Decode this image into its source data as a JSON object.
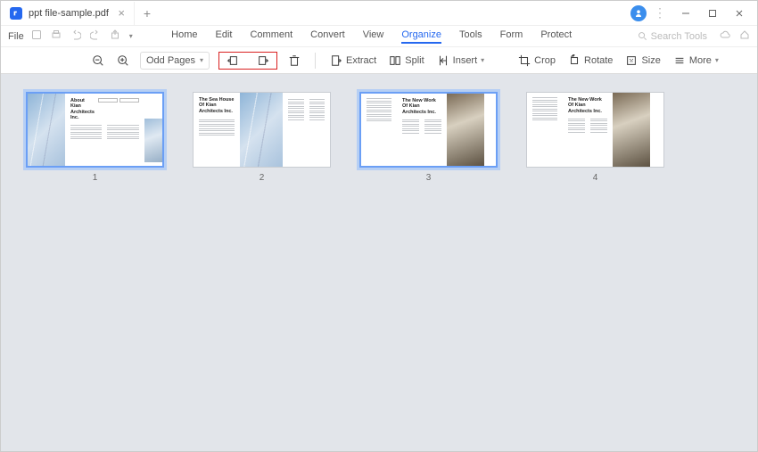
{
  "tab": {
    "title": "ppt file-sample.pdf"
  },
  "menubar": {
    "file": "File",
    "items": [
      "Home",
      "Edit",
      "Comment",
      "Convert",
      "View",
      "Organize",
      "Tools",
      "Form",
      "Protect"
    ],
    "active_index": 5,
    "search_placeholder": "Search Tools"
  },
  "toolbar": {
    "filter_label": "Odd Pages",
    "extract": "Extract",
    "split": "Split",
    "insert": "Insert",
    "crop": "Crop",
    "rotate": "Rotate",
    "size": "Size",
    "more": "More"
  },
  "pages": [
    {
      "num": "1",
      "title": "About Kian Architects Inc.",
      "selected": true,
      "style": "blue",
      "layout": "a"
    },
    {
      "num": "2",
      "title": "The Sea House Of Kian Architects Inc.",
      "selected": false,
      "style": "blue",
      "layout": "b"
    },
    {
      "num": "3",
      "title": "The New Work Of Kian Architects Inc.",
      "selected": true,
      "style": "brown",
      "layout": "c"
    },
    {
      "num": "4",
      "title": "The New Work Of Kian Architects Inc.",
      "selected": false,
      "style": "brown",
      "layout": "c"
    }
  ]
}
